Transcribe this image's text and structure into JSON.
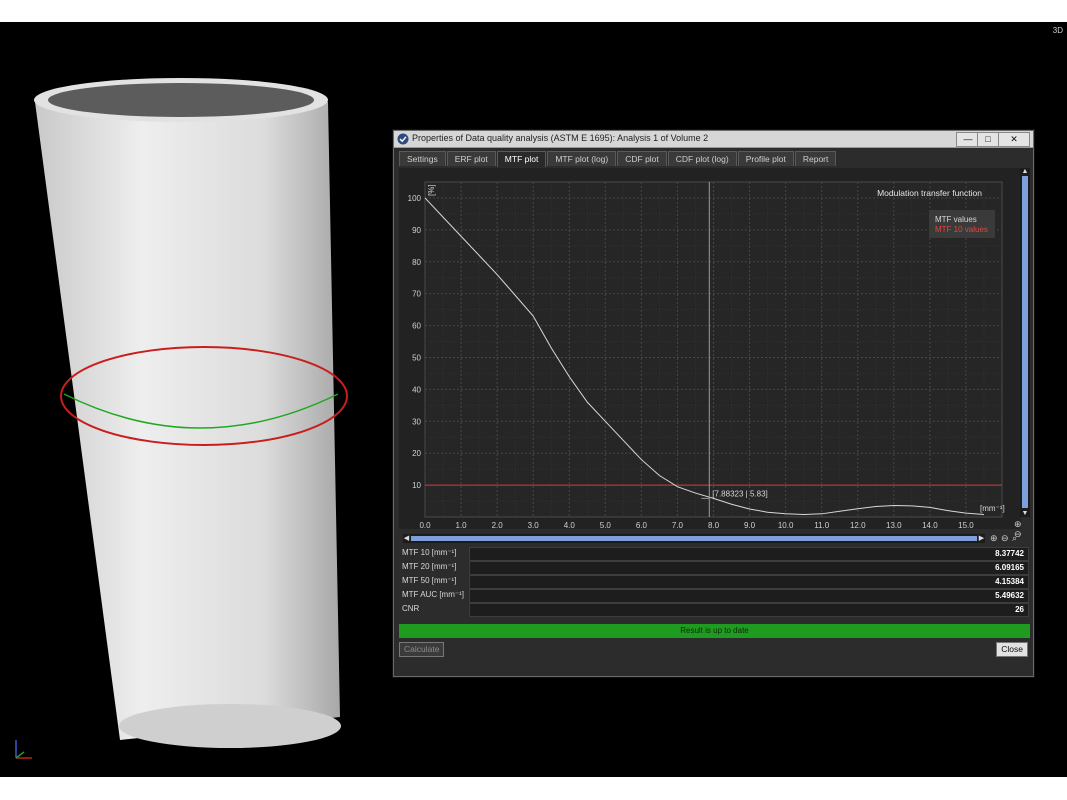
{
  "viewport": {
    "view_label": "3D"
  },
  "dialog": {
    "title": "Properties of Data quality analysis (ASTM E 1695): Analysis 1 of Volume 2",
    "window_buttons": {
      "minimize": "—",
      "maximize": "□",
      "close": "✕"
    },
    "tabs": [
      {
        "label": "Settings",
        "active": false
      },
      {
        "label": "ERF plot",
        "active": false
      },
      {
        "label": "MTF plot",
        "active": true
      },
      {
        "label": "MTF plot (log)",
        "active": false
      },
      {
        "label": "CDF plot",
        "active": false
      },
      {
        "label": "CDF plot (log)",
        "active": false
      },
      {
        "label": "Profile plot",
        "active": false
      },
      {
        "label": "Report",
        "active": false
      }
    ],
    "results": [
      {
        "label": "MTF 10 [mm⁻¹]",
        "value": "8.37742"
      },
      {
        "label": "MTF 20 [mm⁻¹]",
        "value": "6.09165"
      },
      {
        "label": "MTF 50 [mm⁻¹]",
        "value": "4.15384"
      },
      {
        "label": "MTF AUC [mm⁻¹]",
        "value": "5.49632"
      },
      {
        "label": "CNR",
        "value": "26"
      }
    ],
    "status": "Result is up to date",
    "calculate_label": "Calculate",
    "close_label": "Close"
  },
  "colors": {
    "curve": "#d8d8d8",
    "mtf10_line": "#d33a3a",
    "status_green": "#1f9b1f",
    "scroll_blue": "#7f9fdc",
    "ring_red": "#c81e1e",
    "ring_green": "#1ea81e"
  },
  "chart_data": {
    "type": "line",
    "title": "Modulation transfer function",
    "xlabel": "[mm⁻¹]",
    "ylabel": "[%]",
    "xlim": [
      0,
      16
    ],
    "ylim": [
      0,
      105
    ],
    "x_ticks": [
      "0.0",
      "1.0",
      "2.0",
      "3.0",
      "4.0",
      "5.0",
      "6.0",
      "7.0",
      "8.0",
      "9.0",
      "10.0",
      "11.0",
      "12.0",
      "13.0",
      "14.0",
      "15.0"
    ],
    "y_ticks": [
      "10",
      "20",
      "30",
      "40",
      "50",
      "60",
      "70",
      "80",
      "90",
      "100"
    ],
    "grid": true,
    "legend_position": "top-right",
    "series": [
      {
        "name": "MTF values",
        "x": [
          0,
          0.5,
          1.0,
          1.5,
          2.0,
          2.5,
          3.0,
          3.5,
          4.0,
          4.5,
          5.0,
          5.5,
          6.0,
          6.5,
          7.0,
          7.5,
          8.0,
          8.5,
          9.0,
          9.5,
          10.0,
          10.5,
          11.0,
          11.5,
          12.0,
          12.5,
          13.0,
          13.5,
          14.0,
          14.5,
          15.0,
          15.5
        ],
        "y": [
          100,
          94,
          88,
          82,
          76,
          69.5,
          63,
          53,
          44,
          36,
          30,
          24,
          18,
          13,
          9.5,
          7.5,
          5.83,
          4,
          2.5,
          1.5,
          1,
          0.8,
          1,
          1.8,
          2.6,
          3.3,
          3.6,
          3.5,
          3,
          2,
          1.2,
          0.8
        ]
      },
      {
        "name": "MTF 10 values",
        "constant_y": 10
      }
    ],
    "cursor": {
      "x": 7.88323,
      "y": 5.83,
      "label": "[7.88323 | 5.83]"
    }
  }
}
